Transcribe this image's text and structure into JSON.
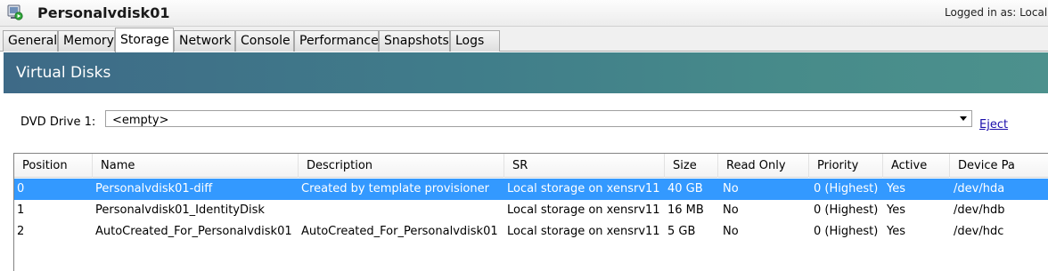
{
  "window": {
    "title": "Personalvdisk01",
    "login_text": "Logged in as:  Local",
    "icon": "vm-icon"
  },
  "tabs": [
    {
      "label": "General"
    },
    {
      "label": "Memory"
    },
    {
      "label": "Storage",
      "active": true
    },
    {
      "label": "Network"
    },
    {
      "label": "Console"
    },
    {
      "label": "Performance"
    },
    {
      "label": "Snapshots"
    },
    {
      "label": "Logs"
    }
  ],
  "banner": {
    "title": "Virtual Disks"
  },
  "dvd": {
    "label": "DVD Drive 1:",
    "value": "<empty>",
    "eject_label": "Eject"
  },
  "table": {
    "columns": [
      "Position",
      "Name",
      "Description",
      "SR",
      "Size",
      "Read Only",
      "Priority",
      "Active",
      "Device Pa"
    ],
    "rows": [
      [
        "0",
        "Personalvdisk01-diff",
        "Created by template provisioner",
        "Local storage on xensrv11",
        "40 GB",
        "No",
        "0 (Highest)",
        "Yes",
        "/dev/hda"
      ],
      [
        "1",
        "Personalvdisk01_IdentityDisk",
        "",
        "Local storage on xensrv11",
        "16 MB",
        "No",
        "0 (Highest)",
        "Yes",
        "/dev/hdb"
      ],
      [
        "2",
        "AutoCreated_For_Personalvdisk01",
        "AutoCreated_For_Personalvdisk01",
        "Local storage on xensrv11",
        "5 GB",
        "No",
        "0 (Highest)",
        "Yes",
        "/dev/hdc"
      ]
    ],
    "selected_row": 0
  },
  "colors": {
    "selection": "#3399ff",
    "banner_start": "#3e6a87",
    "banner_end": "#4c918d",
    "link": "#1a0dab"
  }
}
